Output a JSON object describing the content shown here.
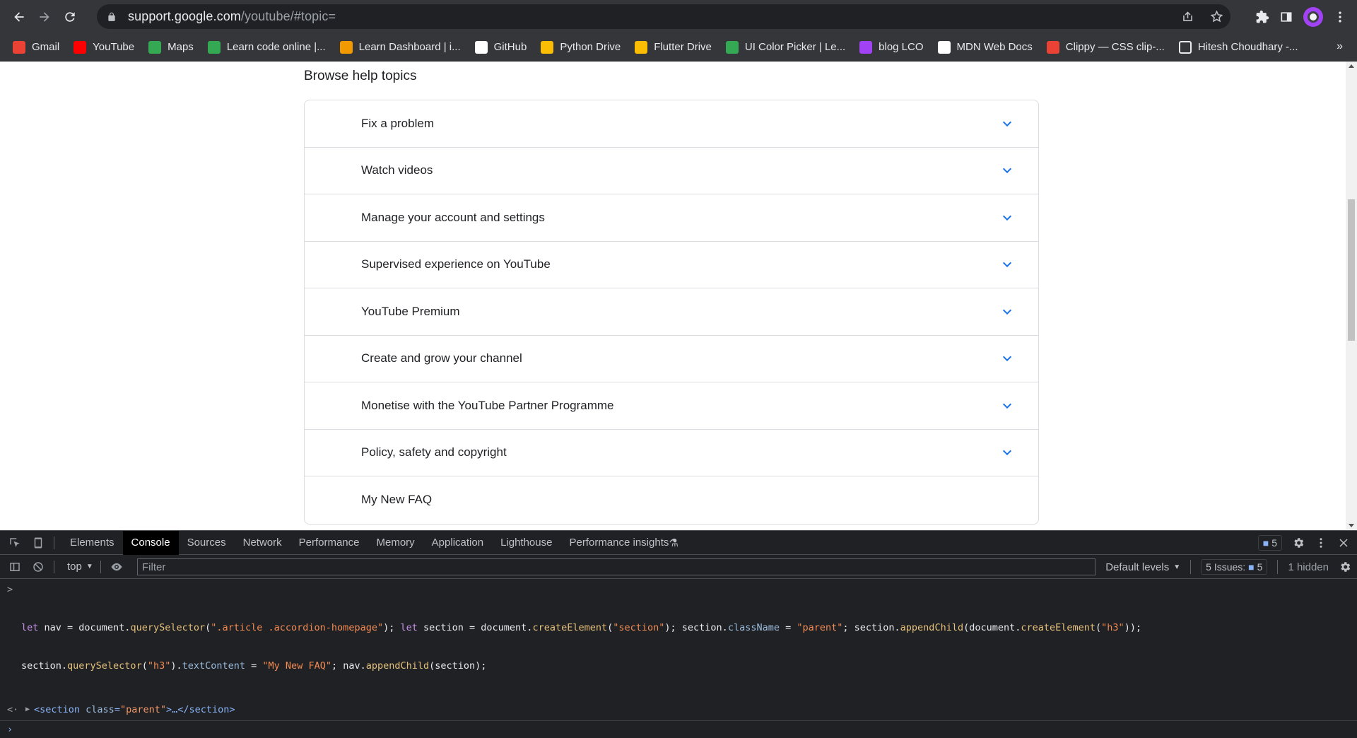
{
  "browser": {
    "url_host": "support.google.com",
    "url_path": "/youtube/#topic=",
    "bookmarks": [
      {
        "label": "Gmail",
        "icon": "gmail-icon",
        "color": "#ea4335"
      },
      {
        "label": "YouTube",
        "icon": "youtube-icon",
        "color": "#ff0000"
      },
      {
        "label": "Maps",
        "icon": "maps-icon",
        "color": "#34a853"
      },
      {
        "label": "Learn code online |...",
        "icon": "learncode-icon",
        "color": "#34a853"
      },
      {
        "label": "Learn Dashboard | i...",
        "icon": "dashboard-icon",
        "color": "#f29900"
      },
      {
        "label": "GitHub",
        "icon": "github-icon",
        "color": "#ffffff"
      },
      {
        "label": "Python Drive",
        "icon": "drive-icon",
        "color": "#fbbc04"
      },
      {
        "label": "Flutter Drive",
        "icon": "drive-icon",
        "color": "#fbbc04"
      },
      {
        "label": "UI Color Picker | Le...",
        "icon": "colorpicker-icon",
        "color": "#34a853"
      },
      {
        "label": "blog LCO",
        "icon": "blog-icon",
        "color": "#a142f4"
      },
      {
        "label": "MDN Web Docs",
        "icon": "mdn-icon",
        "color": "#ffffff"
      },
      {
        "label": "Clippy — CSS clip-...",
        "icon": "clippy-icon",
        "color": "#ea4335"
      },
      {
        "label": "Hitesh Choudhary -...",
        "icon": "page-icon",
        "color": "#e8eaed"
      }
    ],
    "more_bookmarks": "»"
  },
  "page": {
    "section_title": "Browse help topics",
    "topics": [
      {
        "label": "Fix a problem",
        "expandable": true
      },
      {
        "label": "Watch videos",
        "expandable": true
      },
      {
        "label": "Manage your account and settings",
        "expandable": true
      },
      {
        "label": "Supervised experience on YouTube",
        "expandable": true
      },
      {
        "label": "YouTube Premium",
        "expandable": true
      },
      {
        "label": "Create and grow your channel",
        "expandable": true
      },
      {
        "label": "Monetise with the YouTube Partner Programme",
        "expandable": true
      },
      {
        "label": "Policy, safety and copyright",
        "expandable": true
      },
      {
        "label": "My New FAQ",
        "expandable": false
      }
    ]
  },
  "devtools": {
    "tabs": [
      "Elements",
      "Console",
      "Sources",
      "Network",
      "Performance",
      "Memory",
      "Application",
      "Lighthouse",
      "Performance insights"
    ],
    "active_tab": "Console",
    "message_count": "5",
    "context": "top",
    "filter_placeholder": "Filter",
    "levels": "Default levels",
    "issues_label": "5 Issues:",
    "issues_count": "5",
    "hidden": "1 hidden",
    "console_input_line1": "let nav = document.querySelector(\".article .accordion-homepage\"); let section = document.createElement(\"section\"); section.className = \"parent\"; section.appendChild(document.createElement(\"h3\"));",
    "console_input_line2": "section.querySelector(\"h3\").textContent = \"My New FAQ\"; nav.appendChild(section);",
    "result_tag_open": "<section",
    "result_attr": "class",
    "result_attr_value": "\"parent\"",
    "result_ellipsis": ">…</section>"
  }
}
